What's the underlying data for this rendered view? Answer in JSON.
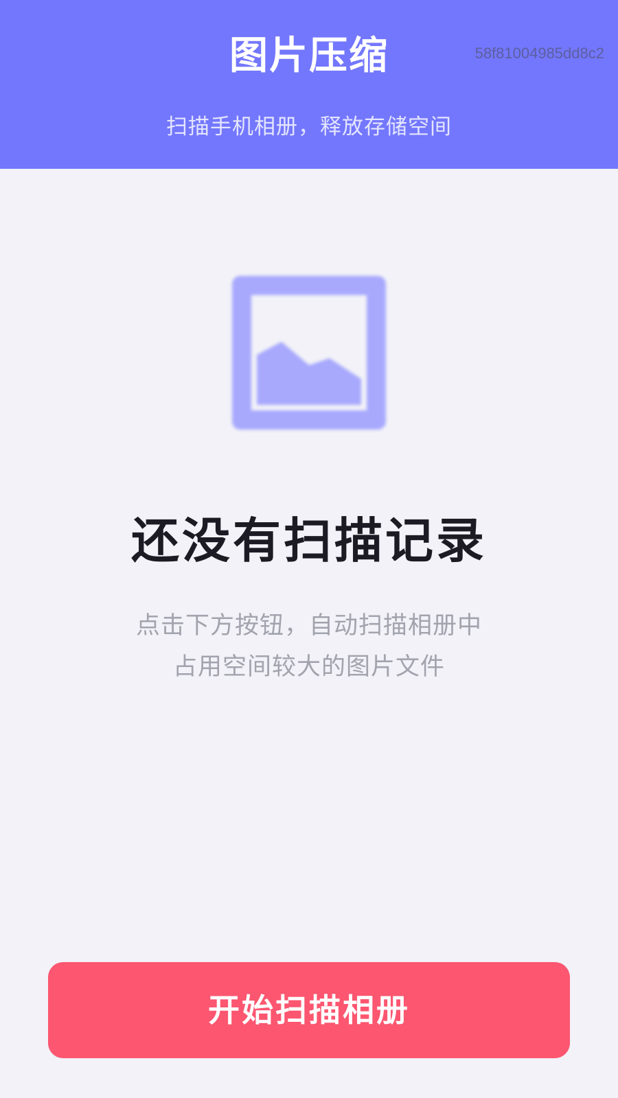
{
  "header": {
    "title": "图片压缩",
    "subtitle": "扫描手机相册，释放存储空间",
    "session_id": "58f81004985dd8c2"
  },
  "empty_state": {
    "icon": "image-placeholder-icon",
    "title": "还没有扫描记录",
    "description_line1": "点击下方按钮，自动扫描相册中",
    "description_line2": "占用空间较大的图片文件"
  },
  "actions": {
    "scan_button_label": "开始扫描相册"
  },
  "colors": {
    "header_bg": "#7377fd",
    "page_bg": "#f2f2f8",
    "icon_accent": "#a8a9fd",
    "button_bg": "#fc5670"
  }
}
